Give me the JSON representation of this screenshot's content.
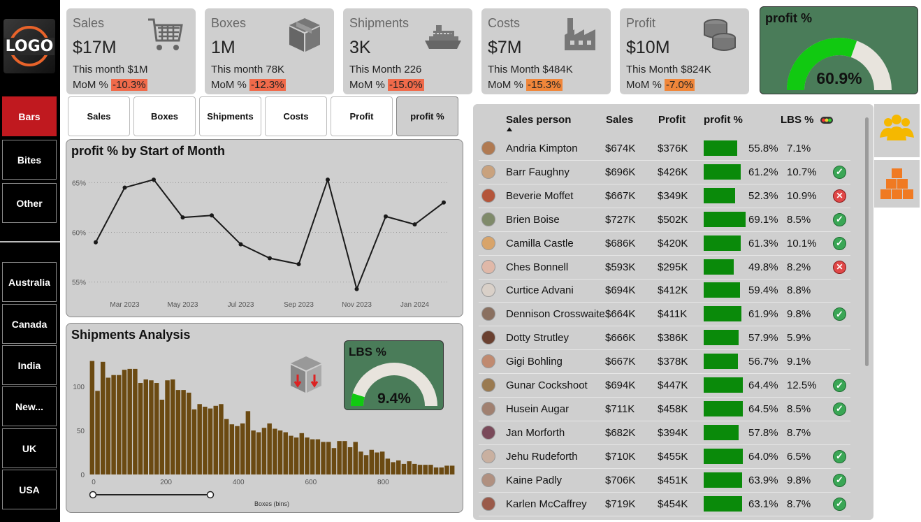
{
  "sidebar": {
    "logo_text": "LOGO",
    "categories": [
      "Bars",
      "Bites",
      "Other"
    ],
    "regions": [
      "Australia",
      "Canada",
      "India",
      "New...",
      "UK",
      "USA"
    ]
  },
  "kpis": [
    {
      "label": "Sales",
      "value": "$17M",
      "month": "This month $1M",
      "mom_label": "MoM %",
      "mom": "-10.3%",
      "icon": "shopping-cart-icon"
    },
    {
      "label": "Boxes",
      "value": "1M",
      "month": "This month 78K",
      "mom_label": "MoM %",
      "mom": "-12.3%",
      "icon": "box-icon"
    },
    {
      "label": "Shipments",
      "value": "3K",
      "month": "This Month 226",
      "mom_label": "MoM %",
      "mom": "-15.0%",
      "icon": "ship-icon"
    },
    {
      "label": "Costs",
      "value": "$7M",
      "month": "This Month $484K",
      "mom_label": "MoM %",
      "mom": "-15.3%",
      "icon": "factory-icon"
    },
    {
      "label": "Profit",
      "value": "$10M",
      "month": "This Month $824K",
      "mom_label": "MoM %",
      "mom": "-7.0%",
      "icon": "coins-icon"
    }
  ],
  "profit_gauge": {
    "title": "profit %",
    "value_text": "60.9%",
    "value": 0.609
  },
  "tabs": [
    "Sales",
    "Boxes",
    "Shipments",
    "Costs",
    "Profit",
    "profit %"
  ],
  "line_panel_title": "profit % by Start of Month",
  "shipments_panel_title": "Shipments Analysis",
  "lbs_gauge": {
    "title": "LBS %",
    "value_text": "9.4%",
    "value": 0.094
  },
  "table": {
    "headers": [
      "Sales person",
      "Sales",
      "Profit",
      "profit %",
      "LBS %"
    ],
    "rows": [
      {
        "name": "Andria Kimpton",
        "sales": "$674K",
        "profit": "$376K",
        "pct": "55.8%",
        "pctv": 55.8,
        "lbs": "7.1%",
        "status": "none",
        "color": "#b07a52"
      },
      {
        "name": "Barr Faughny",
        "sales": "$696K",
        "profit": "$426K",
        "pct": "61.2%",
        "pctv": 61.2,
        "lbs": "10.7%",
        "status": "ok",
        "color": "#c9a27e"
      },
      {
        "name": "Beverie Moffet",
        "sales": "$667K",
        "profit": "$349K",
        "pct": "52.3%",
        "pctv": 52.3,
        "lbs": "10.9%",
        "status": "bad",
        "color": "#b4553a"
      },
      {
        "name": "Brien Boise",
        "sales": "$727K",
        "profit": "$502K",
        "pct": "69.1%",
        "pctv": 69.1,
        "lbs": "8.5%",
        "status": "ok",
        "color": "#7f8a6a"
      },
      {
        "name": "Camilla Castle",
        "sales": "$686K",
        "profit": "$420K",
        "pct": "61.3%",
        "pctv": 61.3,
        "lbs": "10.1%",
        "status": "ok",
        "color": "#d8a46a"
      },
      {
        "name": "Ches Bonnell",
        "sales": "$593K",
        "profit": "$295K",
        "pct": "49.8%",
        "pctv": 49.8,
        "lbs": "8.2%",
        "status": "bad",
        "color": "#e0b8a8"
      },
      {
        "name": "Curtice Advani",
        "sales": "$694K",
        "profit": "$412K",
        "pct": "59.4%",
        "pctv": 59.4,
        "lbs": "8.8%",
        "status": "none",
        "color": "#d9d0c8"
      },
      {
        "name": "Dennison Crosswaite",
        "sales": "$664K",
        "profit": "$411K",
        "pct": "61.9%",
        "pctv": 61.9,
        "lbs": "9.8%",
        "status": "ok",
        "color": "#8a7060"
      },
      {
        "name": "Dotty Strutley",
        "sales": "$666K",
        "profit": "$386K",
        "pct": "57.9%",
        "pctv": 57.9,
        "lbs": "5.9%",
        "status": "none",
        "color": "#6a4030"
      },
      {
        "name": "Gigi Bohling",
        "sales": "$667K",
        "profit": "$378K",
        "pct": "56.7%",
        "pctv": 56.7,
        "lbs": "9.1%",
        "status": "none",
        "color": "#c08a70"
      },
      {
        "name": "Gunar Cockshoot",
        "sales": "$694K",
        "profit": "$447K",
        "pct": "64.4%",
        "pctv": 64.4,
        "lbs": "12.5%",
        "status": "ok",
        "color": "#9a7a50"
      },
      {
        "name": "Husein Augar",
        "sales": "$711K",
        "profit": "$458K",
        "pct": "64.5%",
        "pctv": 64.5,
        "lbs": "8.5%",
        "status": "ok",
        "color": "#a08070"
      },
      {
        "name": "Jan Morforth",
        "sales": "$682K",
        "profit": "$394K",
        "pct": "57.8%",
        "pctv": 57.8,
        "lbs": "8.7%",
        "status": "none",
        "color": "#7a4a5a"
      },
      {
        "name": "Jehu Rudeforth",
        "sales": "$710K",
        "profit": "$455K",
        "pct": "64.0%",
        "pctv": 64.0,
        "lbs": "6.5%",
        "status": "ok",
        "color": "#c9b0a0"
      },
      {
        "name": "Kaine Padly",
        "sales": "$706K",
        "profit": "$451K",
        "pct": "63.9%",
        "pctv": 63.9,
        "lbs": "9.8%",
        "status": "ok",
        "color": "#b09080"
      },
      {
        "name": "Karlen McCaffrey",
        "sales": "$719K",
        "profit": "$454K",
        "pct": "63.1%",
        "pctv": 63.1,
        "lbs": "8.7%",
        "status": "ok",
        "color": "#9a5a4a"
      }
    ]
  },
  "right_buttons": [
    "people-group-icon",
    "boxes-stack-icon"
  ],
  "chart_data": [
    {
      "type": "line",
      "title": "profit % by Start of Month",
      "x": [
        "2023-02",
        "2023-03",
        "2023-04",
        "2023-05",
        "2023-06",
        "2023-07",
        "2023-08",
        "2023-09",
        "2023-10",
        "2023-11",
        "2023-12",
        "2024-01",
        "2024-02"
      ],
      "x_tick_labels": [
        "Mar 2023",
        "May 2023",
        "Jul 2023",
        "Sep 2023",
        "Nov 2023",
        "Jan 2024"
      ],
      "x_ticks": [
        "2023-03",
        "2023-05",
        "2023-07",
        "2023-09",
        "2023-11",
        "2024-01"
      ],
      "values": [
        59.0,
        64.5,
        65.3,
        61.5,
        61.7,
        58.8,
        57.4,
        56.8,
        65.3,
        54.3,
        61.6,
        60.8,
        63.0
      ],
      "ylim": [
        53.5,
        66.5
      ],
      "y_ticks": [
        55,
        60,
        65
      ],
      "y_tick_labels": [
        "55%",
        "60%",
        "65%"
      ],
      "grid": true
    },
    {
      "type": "bar",
      "title": "Shipments Analysis",
      "xlabel": "Boxes (bins)",
      "x_ticks": [
        0,
        200,
        400,
        600,
        800
      ],
      "y_ticks": [
        0,
        50,
        100
      ],
      "ylim": [
        0,
        135
      ],
      "values": [
        129,
        95,
        128,
        110,
        113,
        113,
        119,
        120,
        120,
        104,
        108,
        107,
        104,
        85,
        107,
        108,
        96,
        96,
        93,
        74,
        80,
        77,
        75,
        78,
        80,
        63,
        57,
        55,
        58,
        72,
        50,
        48,
        53,
        58,
        52,
        50,
        48,
        44,
        42,
        47,
        42,
        40,
        40,
        37,
        37,
        30,
        38,
        38,
        31,
        37,
        26,
        22,
        28,
        25,
        26,
        18,
        14,
        16,
        12,
        15,
        12,
        11,
        11,
        11,
        8,
        8,
        10,
        10
      ]
    }
  ]
}
